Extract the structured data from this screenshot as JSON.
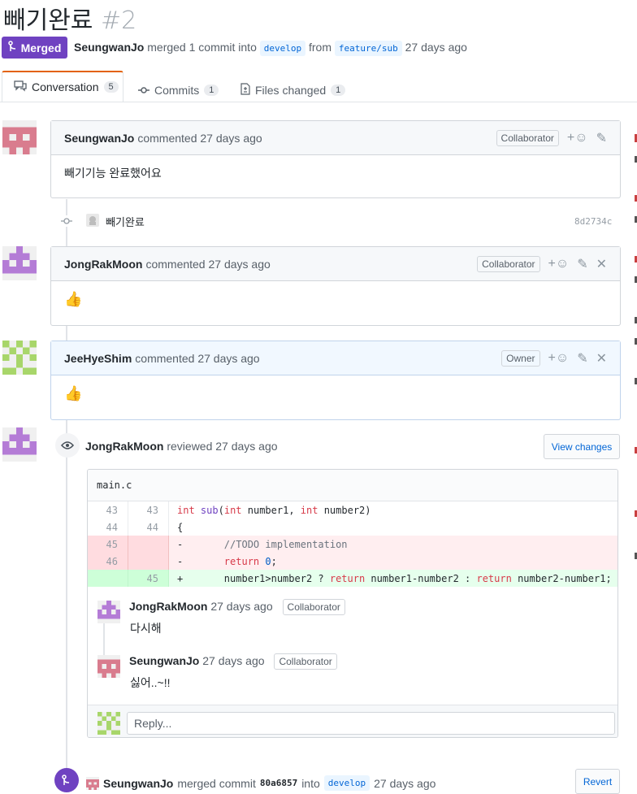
{
  "pr": {
    "title": "빼기완료",
    "number": "#2",
    "state": "Merged",
    "author": "SeungwanJo",
    "summary_mid": "merged 1 commit into",
    "base_branch": "develop",
    "from_word": "from",
    "head_branch": "feature/sub",
    "time": "27 days ago"
  },
  "tabs": [
    {
      "label": "Conversation",
      "count": "5"
    },
    {
      "label": "Commits",
      "count": "1"
    },
    {
      "label": "Files changed",
      "count": "1"
    }
  ],
  "comments": [
    {
      "author": "SeungwanJo",
      "meta": "commented 27 days ago",
      "role": "Collaborator",
      "body": "빼기기능 완료했어요"
    },
    {
      "author": "JongRakMoon",
      "meta": "commented 27 days ago",
      "role": "Collaborator",
      "body": "👍"
    },
    {
      "author": "JeeHyeShim",
      "meta": "commented 27 days ago",
      "role": "Owner",
      "body": "👍"
    }
  ],
  "commit": {
    "message": "빼기완료",
    "sha": "8d2734c"
  },
  "review": {
    "author": "JongRakMoon",
    "meta": "reviewed 27 days ago",
    "view_changes": "View changes",
    "file": "main.c",
    "diff": [
      {
        "old": "43",
        "new": "43",
        "text": "int sub(int number1, int number2)"
      },
      {
        "old": "44",
        "new": "44",
        "text": "{"
      },
      {
        "old": "45",
        "new": "",
        "text": "-       //TODO implementation"
      },
      {
        "old": "46",
        "new": "",
        "text": "-       return 0;"
      },
      {
        "old": "",
        "new": "45",
        "text": "+       number1>number2 ? return number1-number2 : return number2-number1;"
      }
    ],
    "replies": [
      {
        "author": "JongRakMoon",
        "meta": "27 days ago",
        "role": "Collaborator",
        "body": "다시해"
      },
      {
        "author": "SeungwanJo",
        "meta": "27 days ago",
        "role": "Collaborator",
        "body": "싫어..~!!"
      }
    ],
    "reply_placeholder": "Reply..."
  },
  "merge_event": {
    "author": "SeungwanJo",
    "text1": "merged commit",
    "sha": "80a6857",
    "into": "into",
    "branch": "develop",
    "time": "27 days ago",
    "revert": "Revert"
  },
  "icons": {
    "reaction": "+☺",
    "edit": "✎",
    "close": "✕"
  },
  "colors": {
    "merged": "#6f42c1",
    "accent": "#e36209",
    "link": "#0366d6"
  }
}
